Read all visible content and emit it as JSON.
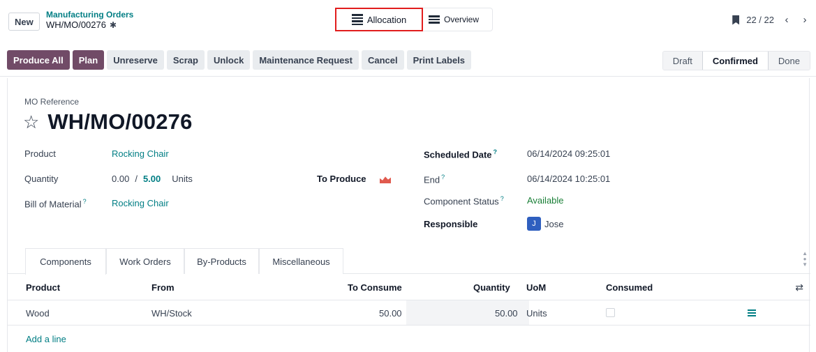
{
  "control_panel": {
    "new_label": "New",
    "breadcrumb_parent": "Manufacturing Orders",
    "breadcrumb_current": "WH/MO/00276",
    "views": {
      "allocation": "Allocation",
      "overview": "Overview"
    },
    "pager": "22 / 22"
  },
  "statusbar": {
    "buttons": [
      "Produce All",
      "Plan",
      "Unreserve",
      "Scrap",
      "Unlock",
      "Maintenance Request",
      "Cancel",
      "Print Labels"
    ],
    "stages": [
      "Draft",
      "Confirmed",
      "Done"
    ],
    "active_stage": "Confirmed"
  },
  "form": {
    "ref_label": "MO Reference",
    "ref_name": "WH/MO/00276",
    "product_label": "Product",
    "product_value": "Rocking Chair",
    "quantity_label": "Quantity",
    "quantity_produced": "0.00",
    "quantity_sep": "/",
    "quantity_target": "5.00",
    "quantity_uom": "Units",
    "to_produce_label": "To Produce",
    "bom_label": "Bill of Material",
    "bom_value": "Rocking Chair",
    "help_mark": "?",
    "scheduled_label": "Scheduled Date",
    "scheduled_value": "06/14/2024 09:25:01",
    "end_label": "End",
    "end_value": "06/14/2024 10:25:01",
    "component_status_label": "Component Status",
    "component_status_value": "Available",
    "responsible_label": "Responsible",
    "responsible_initial": "J",
    "responsible_value": "Jose"
  },
  "tabs": [
    "Components",
    "Work Orders",
    "By-Products",
    "Miscellaneous"
  ],
  "table": {
    "headers": {
      "product": "Product",
      "from": "From",
      "to_consume": "To Consume",
      "quantity": "Quantity",
      "uom": "UoM",
      "consumed": "Consumed"
    },
    "rows": [
      {
        "product": "Wood",
        "from": "WH/Stock",
        "to_consume": "50.00",
        "quantity": "50.00",
        "uom": "Units"
      }
    ],
    "add_line": "Add a line"
  },
  "colors": {
    "primary": "#714b67",
    "link": "#017e84",
    "highlight": "#e11d1d",
    "available": "#1a7f37"
  }
}
